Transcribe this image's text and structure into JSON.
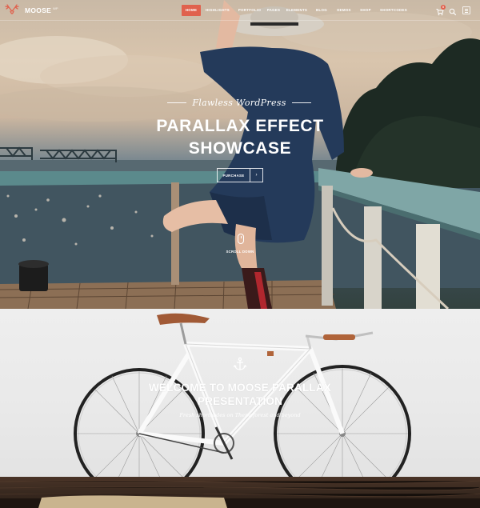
{
  "brand": {
    "name": "MOOSE",
    "sup": "WP",
    "logo_icon": "moose-antlers-icon"
  },
  "nav": {
    "items": [
      {
        "label": "HOME",
        "active": true
      },
      {
        "label": "HIGHLIGHTS",
        "active": false
      },
      {
        "label": "PORTFOLIO",
        "active": false
      },
      {
        "label": "PAGES",
        "active": false
      },
      {
        "label": "ELEMENTS",
        "active": false
      },
      {
        "label": "BLOG",
        "active": false
      },
      {
        "label": "DEMOS",
        "active": false
      },
      {
        "label": "SHOP",
        "active": false
      },
      {
        "label": "SHORTCODES",
        "active": false
      }
    ],
    "cart_icon": "cart-icon",
    "cart_count": "0",
    "search_icon": "search-icon",
    "menu_icon": "hamburger-menu-icon"
  },
  "hero": {
    "kicker": "Flawless WordPress",
    "title_line1": "PARALLAX EFFECT",
    "title_line2": "SHOWCASE",
    "button_label": "PURCHASE",
    "button_icon": "chevron-right-icon",
    "scroll_label": "SCROLL DOWN",
    "scroll_icon": "mouse-icon"
  },
  "section2": {
    "icon": "anchor-icon",
    "title_line1": "WELCOME TO MOOSE PARALLAX",
    "title_line2": "PRESENTATION",
    "subtitle": "Fresh shortcodes on Themeforest and beyond"
  },
  "colors": {
    "accent": "#e0614d",
    "white": "#ffffff",
    "section_bg": "#ececec",
    "wood": "#3a2a20"
  }
}
